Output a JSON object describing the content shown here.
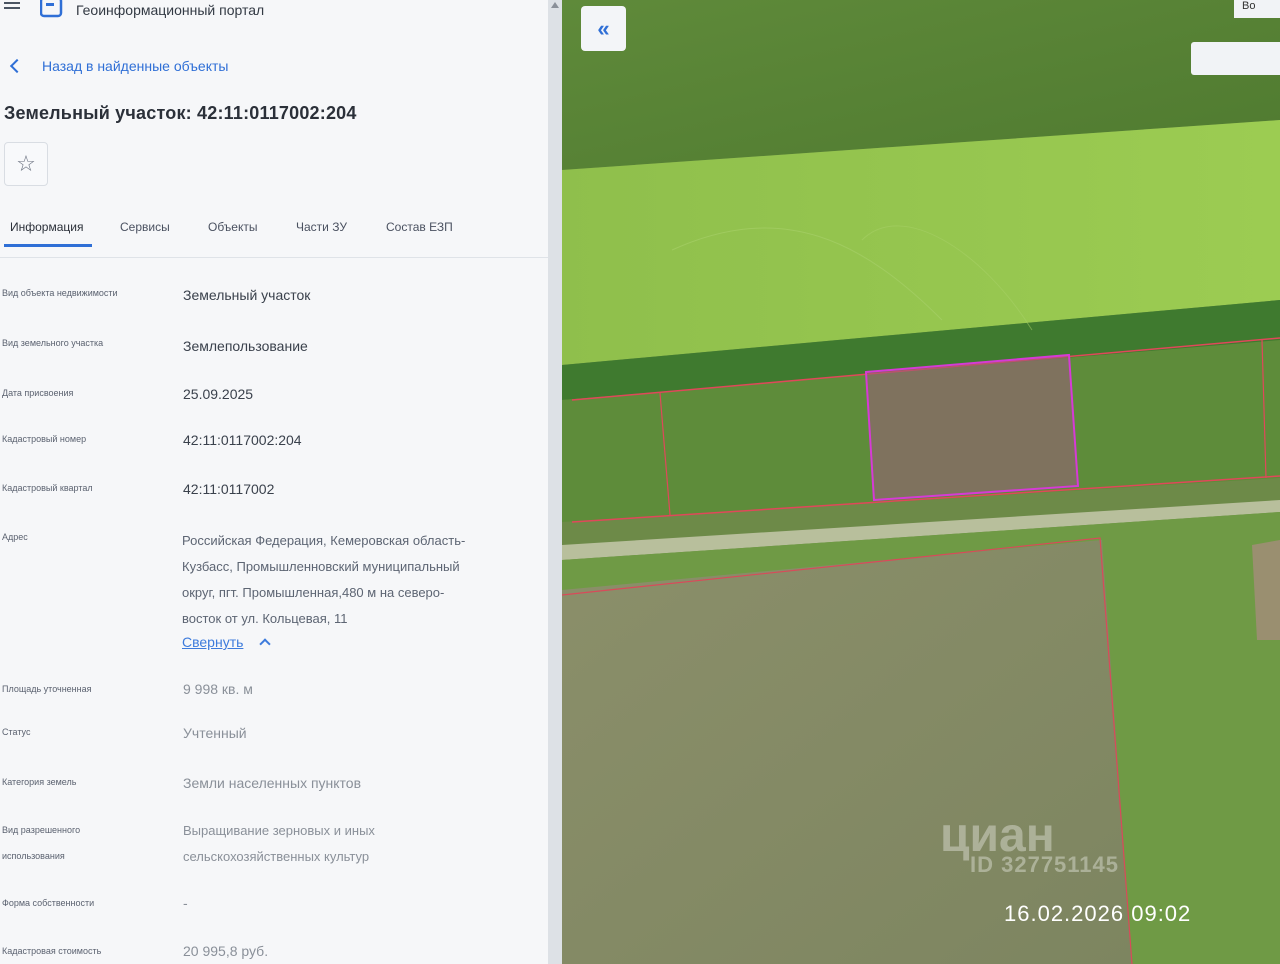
{
  "header": {
    "portal_title": "Геоинформационный портал"
  },
  "nav": {
    "back_label": "Назад в найденные объекты"
  },
  "object": {
    "title": "Земельный участок: 42:11:0117002:204"
  },
  "tabs": [
    {
      "label": "Информация",
      "active": true
    },
    {
      "label": "Сервисы",
      "active": false
    },
    {
      "label": "Объекты",
      "active": false
    },
    {
      "label": "Части ЗУ",
      "active": false
    },
    {
      "label": "Состав ЕЗП",
      "active": false
    }
  ],
  "info": {
    "property_type_label": "Вид объекта недвижимости",
    "property_type_value": "Земельный участок",
    "land_plot_type_label": "Вид земельного участка",
    "land_plot_type_value": "Землепользование",
    "assign_date_label": "Дата присвоения",
    "assign_date_value": "25.09.2025",
    "cadastral_number_label": "Кадастровый номер",
    "cadastral_number_value": "42:11:0117002:204",
    "cadastral_quarter_label": "Кадастровый квартал",
    "cadastral_quarter_value": "42:11:0117002",
    "address_label": "Адрес",
    "address_lines": [
      "Российская Федерация, Кемеровская область-",
      "Кузбасс, Промышленновский муниципальный",
      "округ, пгт. Промышленная,480 м на северо-",
      "восток от ул. Кольцевая, 11"
    ],
    "collapse_label": "Свернуть",
    "area_label": "Площадь уточненная",
    "area_value": "9 998 кв. м",
    "status_label": "Статус",
    "status_value": "Учтенный",
    "category_label": "Категория земель",
    "category_value": "Земли населенных пунктов",
    "permitted_use_label_1": "Вид разрешенного",
    "permitted_use_label_2": "использования",
    "permitted_use_value_1": "Выращивание зерновых и иных",
    "permitted_use_value_2": "сельскохозяйственных культур",
    "ownership_label": "Форма собственности",
    "ownership_value": "-",
    "cadastral_cost_label": "Кадастровая стоимость",
    "cadastral_cost_value": "20 995,8 руб."
  },
  "map": {
    "collapse_glyph": "«",
    "user_label": "Во",
    "watermark_brand": "циан",
    "watermark_id": "ID 327751145",
    "timestamp": "16.02.2026  09:02"
  },
  "colors": {
    "accent": "#2f6fd6",
    "selected_parcel": "#d63ad6",
    "parcel_border": "#e0485a"
  }
}
